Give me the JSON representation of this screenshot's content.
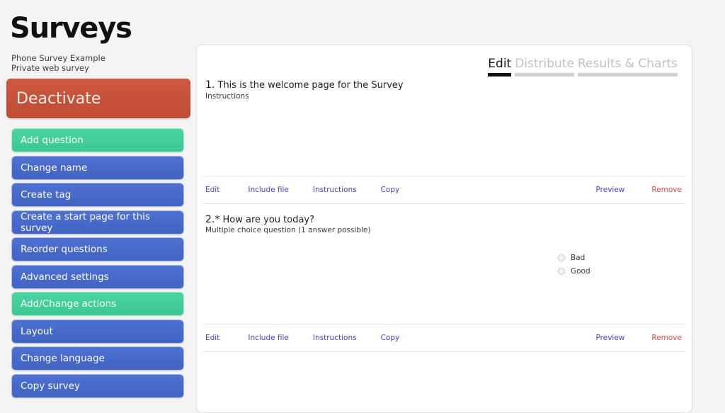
{
  "app": {
    "title": "Surveys",
    "survey_name": "Phone Survey Example",
    "survey_type": "Private web survey"
  },
  "sidebar": {
    "deactivate_label": "Deactivate",
    "items": [
      {
        "label": "Add question",
        "style": "green"
      },
      {
        "label": "Change name",
        "style": "blue"
      },
      {
        "label": "Create tag",
        "style": "blue"
      },
      {
        "label": "Create a start page for this survey",
        "style": "blue"
      },
      {
        "label": "Reorder questions",
        "style": "blue"
      },
      {
        "label": "Advanced settings",
        "style": "blue"
      },
      {
        "label": "Add/Change actions",
        "style": "green"
      },
      {
        "label": "Layout",
        "style": "blue"
      },
      {
        "label": "Change language",
        "style": "blue"
      },
      {
        "label": "Copy survey",
        "style": "blue"
      }
    ]
  },
  "main": {
    "tabs": [
      {
        "label": "Edit",
        "active": true
      },
      {
        "label": "Distribute",
        "active": false
      },
      {
        "label": "Results & Charts",
        "active": false
      }
    ],
    "questions": [
      {
        "number": "1.",
        "title": "This is the welcome page for the Survey",
        "subtitle": "Instructions",
        "options": []
      },
      {
        "number": "2.*",
        "title": "How are you today?",
        "subtitle": "Multiple choice question (1 answer possible)",
        "options": [
          {
            "label": "Bad",
            "selected": false
          },
          {
            "label": "Good",
            "selected": false
          }
        ]
      }
    ],
    "actions": {
      "left": [
        "Edit",
        "Include file",
        "Instructions",
        "Copy"
      ],
      "right": [
        "Preview",
        "Remove"
      ]
    }
  },
  "colors": {
    "background": "#f4f4f4",
    "deactivate": "#c9503c",
    "sidebar_blue": "#4869c8",
    "sidebar_green": "#42cd99",
    "link_blue": "#4a3fd0",
    "link_red": "#e04a4a",
    "tab_active": "#0d0d0d",
    "tab_inactive": "#c2c2c2"
  }
}
